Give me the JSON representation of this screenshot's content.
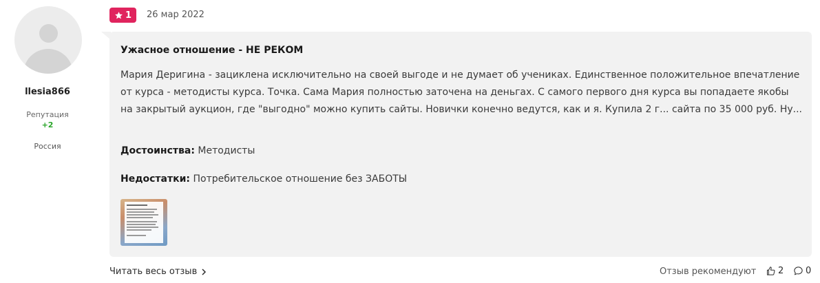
{
  "user": {
    "name": "llesia866",
    "reputation_label": "Репутация",
    "reputation_value": "+2",
    "country": "Россия"
  },
  "review": {
    "rating": "1",
    "date": "26 мар 2022",
    "title": "Ужасное отношение - НЕ РЕКОМ",
    "text": "Мария Деригина - зациклена исключительно на своей выгоде и не думает об учениках. Единственное положительное впечатление от курса - методисты курса. Точка. Сама Мария полностью заточена на деньгах. С самого первого дня курса вы попадаете якобы на закрытый аукцион, где \"выгодно\" можно купить сайты. Новички конечно ведутся, как и я. Купила 2 г... сайта по 35 000 руб. Ну...",
    "pros_label": "Достоинства:",
    "pros_text": " Методисты",
    "cons_label": "Недостатки:",
    "cons_text": " Потребительское отношение без ЗАБОТЫ"
  },
  "footer": {
    "read_full_label": "Читать весь отзыв",
    "recommend_label": "Отзыв рекомендуют",
    "likes_count": "2",
    "comments_count": "0"
  },
  "colors": {
    "badge": "#e0245e",
    "reputation": "#2aa52a",
    "bubble": "#f2f2f2"
  },
  "icons": {
    "rating": "star-icon",
    "read_more": "chevron-right-icon",
    "likes": "thumbs-up-icon",
    "comments": "comment-icon"
  }
}
